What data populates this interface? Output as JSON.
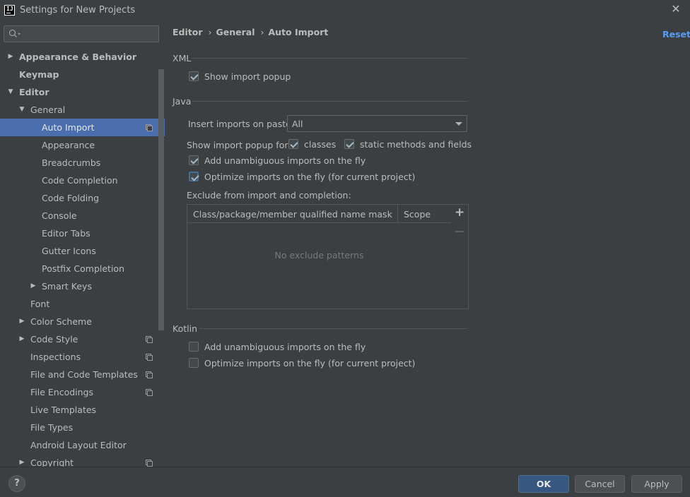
{
  "window": {
    "title": "Settings for New Projects",
    "logo_text": "IJ"
  },
  "search": {
    "placeholder": "",
    "value": ""
  },
  "sidebar": {
    "items": [
      {
        "label": "Appearance & Behavior",
        "level": 0,
        "bold": true,
        "arrow": "right",
        "copy": false,
        "selected": false
      },
      {
        "label": "Keymap",
        "level": 0,
        "bold": true,
        "arrow": "none",
        "copy": false,
        "selected": false
      },
      {
        "label": "Editor",
        "level": 0,
        "bold": true,
        "arrow": "down",
        "copy": false,
        "selected": false
      },
      {
        "label": "General",
        "level": 1,
        "bold": false,
        "arrow": "down",
        "copy": false,
        "selected": false
      },
      {
        "label": "Auto Import",
        "level": 2,
        "bold": false,
        "arrow": "none",
        "copy": true,
        "selected": true
      },
      {
        "label": "Appearance",
        "level": 2,
        "bold": false,
        "arrow": "none",
        "copy": false,
        "selected": false
      },
      {
        "label": "Breadcrumbs",
        "level": 2,
        "bold": false,
        "arrow": "none",
        "copy": false,
        "selected": false
      },
      {
        "label": "Code Completion",
        "level": 2,
        "bold": false,
        "arrow": "none",
        "copy": false,
        "selected": false
      },
      {
        "label": "Code Folding",
        "level": 2,
        "bold": false,
        "arrow": "none",
        "copy": false,
        "selected": false
      },
      {
        "label": "Console",
        "level": 2,
        "bold": false,
        "arrow": "none",
        "copy": false,
        "selected": false
      },
      {
        "label": "Editor Tabs",
        "level": 2,
        "bold": false,
        "arrow": "none",
        "copy": false,
        "selected": false
      },
      {
        "label": "Gutter Icons",
        "level": 2,
        "bold": false,
        "arrow": "none",
        "copy": false,
        "selected": false
      },
      {
        "label": "Postfix Completion",
        "level": 2,
        "bold": false,
        "arrow": "none",
        "copy": false,
        "selected": false
      },
      {
        "label": "Smart Keys",
        "level": 2,
        "bold": false,
        "arrow": "right",
        "copy": false,
        "selected": false
      },
      {
        "label": "Font",
        "level": 1,
        "bold": false,
        "arrow": "none",
        "copy": false,
        "selected": false
      },
      {
        "label": "Color Scheme",
        "level": 1,
        "bold": false,
        "arrow": "right",
        "copy": false,
        "selected": false
      },
      {
        "label": "Code Style",
        "level": 1,
        "bold": false,
        "arrow": "right",
        "copy": true,
        "selected": false
      },
      {
        "label": "Inspections",
        "level": 1,
        "bold": false,
        "arrow": "none",
        "copy": true,
        "selected": false
      },
      {
        "label": "File and Code Templates",
        "level": 1,
        "bold": false,
        "arrow": "none",
        "copy": true,
        "selected": false
      },
      {
        "label": "File Encodings",
        "level": 1,
        "bold": false,
        "arrow": "none",
        "copy": true,
        "selected": false
      },
      {
        "label": "Live Templates",
        "level": 1,
        "bold": false,
        "arrow": "none",
        "copy": false,
        "selected": false
      },
      {
        "label": "File Types",
        "level": 1,
        "bold": false,
        "arrow": "none",
        "copy": false,
        "selected": false
      },
      {
        "label": "Android Layout Editor",
        "level": 1,
        "bold": false,
        "arrow": "none",
        "copy": false,
        "selected": false
      },
      {
        "label": "Copyright",
        "level": 1,
        "bold": false,
        "arrow": "right",
        "copy": true,
        "selected": false
      }
    ]
  },
  "breadcrumb": {
    "items": [
      "Editor",
      "General",
      "Auto Import"
    ],
    "separator": "›"
  },
  "reset_label": "Reset",
  "xml": {
    "title": "XML",
    "show_import_popup": {
      "label": "Show import popup",
      "checked": true
    }
  },
  "java": {
    "title": "Java",
    "insert_imports_label": "Insert imports on paste:",
    "insert_imports_value": "All",
    "show_popup_for_label": "Show import popup for:",
    "classes": {
      "label": "classes",
      "checked": true
    },
    "static_methods": {
      "label": "static methods and fields",
      "checked": true
    },
    "add_unambiguous": {
      "label": "Add unambiguous imports on the fly",
      "checked": true
    },
    "optimize_imports": {
      "label": "Optimize imports on the fly (for current project)",
      "checked": true
    },
    "exclude_label": "Exclude from import and completion:",
    "table": {
      "columns": [
        "Class/package/member qualified name mask",
        "Scope"
      ],
      "empty_text": "No exclude patterns"
    }
  },
  "kotlin": {
    "title": "Kotlin",
    "add_unambiguous": {
      "label": "Add unambiguous imports on the fly",
      "checked": false
    },
    "optimize_imports": {
      "label": "Optimize imports on the fly (for current project)",
      "checked": false
    }
  },
  "footer": {
    "help_label": "?",
    "ok_label": "OK",
    "cancel_label": "Cancel",
    "apply_label": "Apply"
  },
  "colors": {
    "background": "#3c3f41",
    "selection": "#4b6eaf",
    "link": "#589df6",
    "primary_button": "#365880"
  }
}
